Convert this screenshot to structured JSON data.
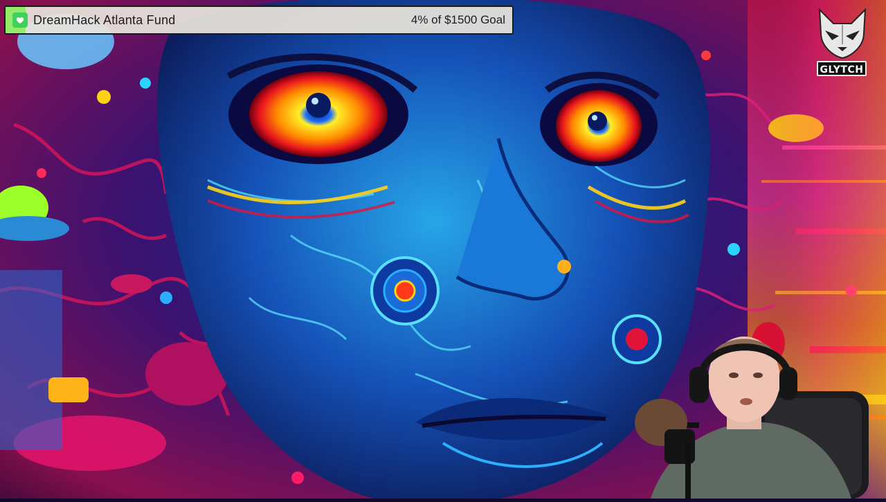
{
  "goal_bar": {
    "title": "DreamHack Atlanta Fund",
    "progress_text": "4% of $1500 Goal",
    "progress_fraction": 0.04,
    "icon": "gift-heart-icon",
    "accent_color": "#53fc18"
  },
  "logo": {
    "text": "GLYTCH",
    "icon": "fox-head-icon"
  },
  "scene": {
    "background_colors": [
      "#0b1a5a",
      "#1f6bd1",
      "#d11a6a",
      "#6a1aa0",
      "#ffcc00",
      "#ff2a2a"
    ]
  }
}
